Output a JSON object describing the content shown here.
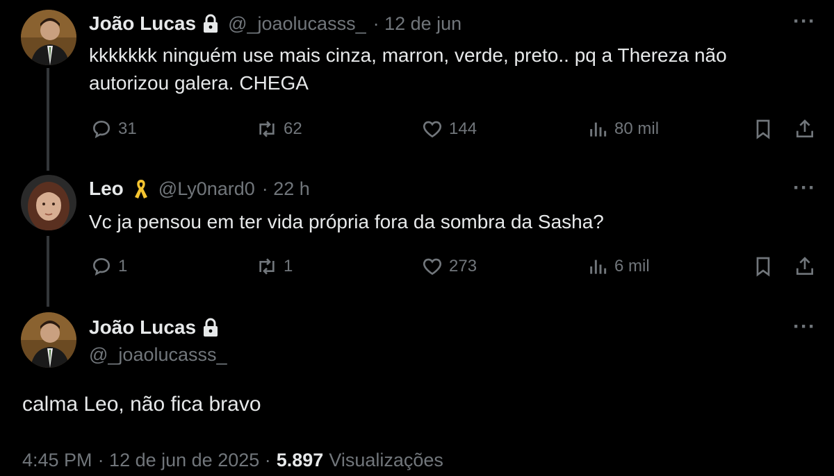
{
  "tweets": [
    {
      "name": "João Lucas",
      "handle": "@_joaolucasss_",
      "time": "· 12 de jun",
      "text_line1": "kkkkkkk ninguém use mais cinza, marron, verde, preto.. pq a Thereza não",
      "text_line2": "autorizou galera. CHEGA",
      "replies": "31",
      "retweets": "62",
      "likes": "144",
      "views": "80 mil",
      "badge": "lock-icon"
    },
    {
      "name": "Leo",
      "handle": "@Ly0nard0",
      "time": "· 22 h",
      "text_line1": "Vc ja pensou em ter vida própria fora da sombra da Sasha?",
      "replies": "1",
      "retweets": "1",
      "likes": "273",
      "views": "6 mil",
      "badge": "ribbon-icon"
    }
  ],
  "main_tweet": {
    "name": "João Lucas",
    "handle": "@_joaolucasss_",
    "text": "calma Leo, não fica bravo",
    "time": "4:45 PM",
    "date": "· 12 de jun de 2025 ·",
    "views_count": "5.897",
    "views_label": "Visualizações",
    "badge": "lock-icon"
  },
  "colors": {
    "background": "#000000",
    "text": "#e7e9ea",
    "muted": "#71767b",
    "ribbon": "#f4c430"
  }
}
